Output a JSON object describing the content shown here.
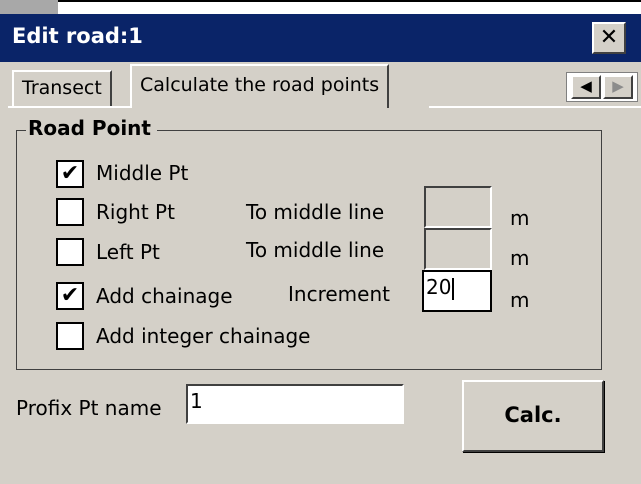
{
  "window": {
    "title": "Edit road:1",
    "close_label": "✕"
  },
  "tabs": [
    {
      "label": "Transect",
      "active": false
    },
    {
      "label": "Calculate the road points",
      "active": true
    }
  ],
  "tab_scroll": {
    "left_arrow": "◀",
    "right_arrow": "▶"
  },
  "road_point": {
    "group_label": "Road Point",
    "middle": {
      "label": "Middle Pt",
      "checked": true
    },
    "right": {
      "label": "Right Pt",
      "checked": false,
      "distance_label": "To middle line",
      "value": "",
      "unit": "m"
    },
    "left": {
      "label": "Left Pt",
      "checked": false,
      "distance_label": "To middle line",
      "value": "",
      "unit": "m"
    },
    "chainage": {
      "label": "Add chainage",
      "checked": true,
      "increment_label": "Increment",
      "value": "20",
      "unit": "m"
    },
    "integer_chainage": {
      "label": "Add integer chainage",
      "checked": false
    }
  },
  "profix": {
    "label": "Profix Pt name",
    "value": "1"
  },
  "calc_button": {
    "label": "Calc."
  },
  "check_glyph": "✔"
}
